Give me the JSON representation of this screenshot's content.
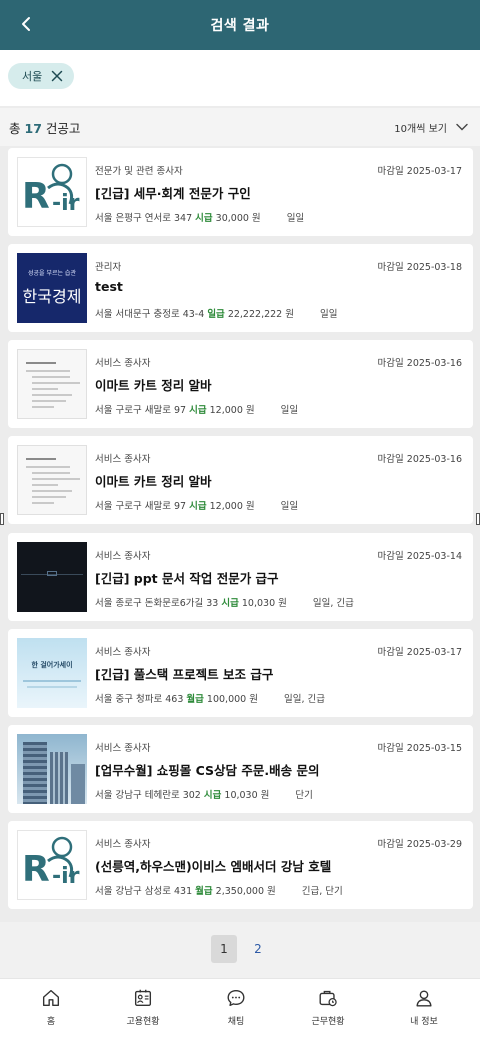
{
  "header": {
    "title": "검색 결과",
    "back_icon": "chevron-left-icon"
  },
  "filter_chip": {
    "label": "서울",
    "remove_icon": "close-icon"
  },
  "result_summary": {
    "prefix": "총",
    "count": "17",
    "suffix": "건공고",
    "sort_label": "10개씩 보기",
    "sort_icon": "chevron-down-icon"
  },
  "jobs": [
    {
      "thumb": "logo",
      "category": "전문가 및 관련 종사자",
      "deadline": "마감일 2025-03-17",
      "title": "[긴급] 세무·회계 전문가 구인",
      "address": "서울 은평구 연서로 347",
      "pay_type": "시급",
      "pay": "30,000 원",
      "schedule": "일일"
    },
    {
      "thumb": "book",
      "category": "관리자",
      "deadline": "마감일 2025-03-18",
      "title": "test",
      "address": "서울 서대문구 충정로 43-4",
      "pay_type": "일급",
      "pay": "22,222,222 원",
      "schedule": "일일",
      "book_small": "성공을 부르는 습관",
      "book_big": "한국경제"
    },
    {
      "thumb": "doc",
      "category": "서비스 종사자",
      "deadline": "마감일 2025-03-16",
      "title": "이마트 카트 정리 알바",
      "address": "서울 구로구 새말로 97",
      "pay_type": "시급",
      "pay": "12,000 원",
      "schedule": "일일"
    },
    {
      "thumb": "doc",
      "category": "서비스 종사자",
      "deadline": "마감일 2025-03-16",
      "title": "이마트 카트 정리 알바",
      "address": "서울 구로구 새말로 97",
      "pay_type": "시급",
      "pay": "12,000 원",
      "schedule": "일일"
    },
    {
      "thumb": "dark",
      "category": "서비스 종사자",
      "deadline": "마감일 2025-03-14",
      "title": "[긴급] ppt 문서 작업 전문가 급구",
      "address": "서울 종로구 돈화문로6가길 33",
      "pay_type": "시급",
      "pay": "10,030 원",
      "schedule": "일일, 긴급"
    },
    {
      "thumb": "sky",
      "category": "서비스 종사자",
      "deadline": "마감일 2025-03-17",
      "title": "[긴급] 풀스택 프로젝트 보조 급구",
      "address": "서울 중구 청파로 463",
      "pay_type": "월급",
      "pay": "100,000 원",
      "schedule": "일일, 긴급",
      "sky_text": "한 걸어가세이"
    },
    {
      "thumb": "bldg",
      "category": "서비스 종사자",
      "deadline": "마감일 2025-03-15",
      "title": "[업무수월] 쇼핑몰 CS상담 주문.배송 문의",
      "address": "서울 강남구 테헤란로 302",
      "pay_type": "시급",
      "pay": "10,030 원",
      "schedule": "단기"
    },
    {
      "thumb": "logo",
      "category": "서비스 종사자",
      "deadline": "마감일 2025-03-29",
      "title": "(선릉역,하우스맨)이비스 엠배서더 강남 호텔",
      "address": "서울 강남구 삼성로 431",
      "pay_type": "월급",
      "pay": "2,350,000 원",
      "schedule": "긴급, 단기"
    }
  ],
  "pagination": {
    "pages": [
      "1",
      "2"
    ],
    "current": "1"
  },
  "bottom_nav": [
    {
      "label": "홈",
      "icon": "home-icon"
    },
    {
      "label": "고용현황",
      "icon": "employment-icon"
    },
    {
      "label": "채팅",
      "icon": "chat-icon"
    },
    {
      "label": "근무현황",
      "icon": "work-status-icon"
    },
    {
      "label": "내 정보",
      "icon": "profile-icon"
    }
  ],
  "colors": {
    "header": "#2d6673",
    "accent": "#2d6b78",
    "pay": "#2e8b3a",
    "chip": "#d6ecec"
  }
}
